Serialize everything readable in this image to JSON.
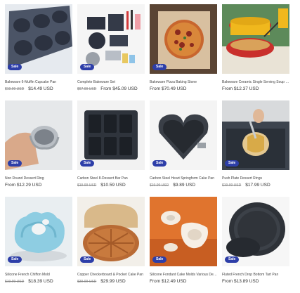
{
  "products": [
    {
      "title": "Bakeware 6-Muffin Cupcake Pan",
      "old_price": "$19.99 USD",
      "price": "$14.49 USD",
      "from": "",
      "badge": "Sale"
    },
    {
      "title": "Complete Bakeware Set",
      "old_price": "$67.99 USD",
      "price": "$45.09 USD",
      "from": "From",
      "badge": "Sale"
    },
    {
      "title": "Bakeware Pizza Baking Stone",
      "old_price": "",
      "price": "$70.49 USD",
      "from": "From",
      "badge": "Sale"
    },
    {
      "title": "Bakeware Ceramic Single Serving Soup Bowl w/ Lid",
      "old_price": "",
      "price": "$12.37 USD",
      "from": "From",
      "badge": ""
    },
    {
      "title": "Non Round Dessert Ring",
      "old_price": "",
      "price": "$12.29 USD",
      "from": "From",
      "badge": "Sale"
    },
    {
      "title": "Carbon Steel 8-Dessert Bar Pan",
      "old_price": "$19.99 USD",
      "price": "$10.59 USD",
      "from": "",
      "badge": "Sale"
    },
    {
      "title": "Carbon Steel Heart Springform Cake Pan",
      "old_price": "$19.99 USD",
      "price": "$9.89 USD",
      "from": "",
      "badge": "Sale"
    },
    {
      "title": "Push Plate Dessert Rings",
      "old_price": "$19.99 USD",
      "price": "$17.99 USD",
      "from": "",
      "badge": "Sale"
    },
    {
      "title": "Silicone French Chiffon Mold",
      "old_price": "$19.99 USD",
      "price": "$18.39 USD",
      "from": "",
      "badge": "Sale"
    },
    {
      "title": "Copper Checkerboard & Pocket Cake Pan",
      "old_price": "$39.99 USD",
      "price": "$29.99 USD",
      "from": "",
      "badge": "Sale"
    },
    {
      "title": "Silicone Fondant Cake Molds Various Designs",
      "old_price": "",
      "price": "$12.49 USD",
      "from": "From",
      "badge": "Sale"
    },
    {
      "title": "Fluted French Drop Bottom Tart Pan",
      "old_price": "",
      "price": "$13.89 USD",
      "from": "From",
      "badge": "Sale"
    }
  ],
  "colors": {
    "badge": "#2d3ea8",
    "pan_dark": "#3d4452",
    "copper": "#c87a3e",
    "bowl_yellow": "#f0b81d",
    "bowl_red": "#c9302c",
    "silicone_blue": "#8ecde2"
  }
}
